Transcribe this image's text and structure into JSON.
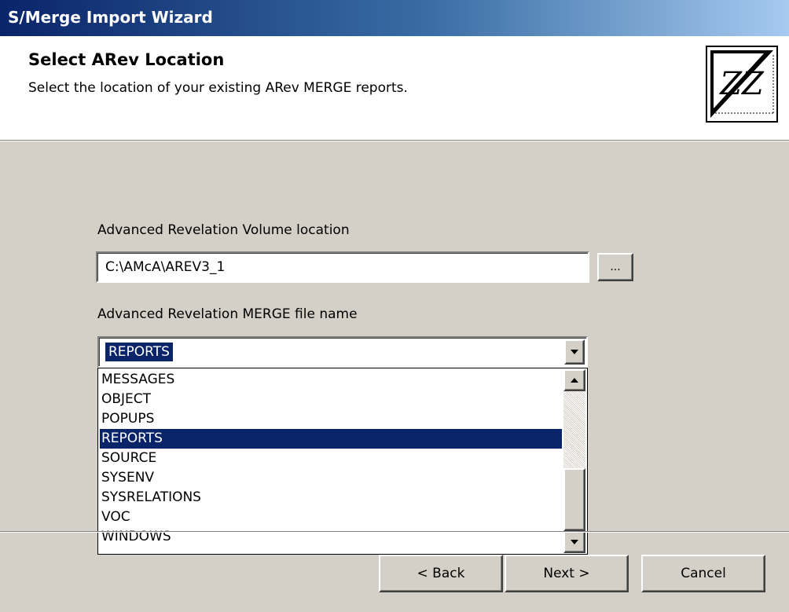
{
  "window": {
    "title": "S/Merge Import Wizard"
  },
  "header": {
    "title": "Select ARev Location",
    "subtitle": "Select the location of your existing ARev MERGE reports.",
    "logo_text": "ZZ"
  },
  "volume": {
    "label": "Advanced Revelation Volume location",
    "value": "C:\\AMcA\\AREV3_1",
    "browse_label": "..."
  },
  "merge_file": {
    "label": "Advanced Revelation MERGE file name",
    "selected": "REPORTS",
    "options": [
      "MESSAGES",
      "OBJECT",
      "POPUPS",
      "REPORTS",
      "SOURCE",
      "SYSENV",
      "SYSRELATIONS",
      "VOC",
      "WINDOWS"
    ]
  },
  "buttons": {
    "back": "< Back",
    "next": "Next >",
    "cancel": "Cancel"
  },
  "colors": {
    "selection": "#0a246a",
    "face": "#d4d0c8"
  }
}
